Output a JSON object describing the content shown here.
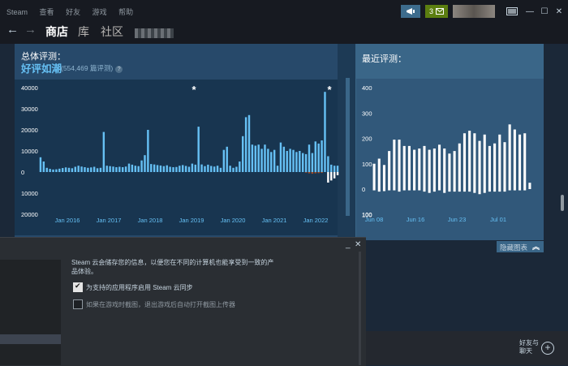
{
  "titlebar": {
    "menu": [
      "Steam",
      "查看",
      "好友",
      "游戏",
      "帮助"
    ],
    "friend_count": "3",
    "window_controls": [
      "—",
      "☐",
      "✕"
    ]
  },
  "navbar": {
    "back": "←",
    "forward": "→",
    "tabs": [
      "商店",
      "库",
      "社区"
    ],
    "active_tab": "商店"
  },
  "overall_reviews": {
    "label": "总体评测：",
    "rating": "好评如潮",
    "count": "(554,469 篇评测)",
    "help": "?"
  },
  "recent_reviews": {
    "label": "最近评测："
  },
  "hide_chart": {
    "label": "隐藏图表",
    "icon": "double-chevron-up-icon"
  },
  "dialog": {
    "controls": [
      "_",
      "✕"
    ],
    "description": "Steam 云会储存您的信息，以便您在不同的计算机也能享受到一致的产品体验。",
    "options": [
      {
        "label": "为支持的应用程序启用 Steam 云同步",
        "checked": true
      },
      {
        "label": "如果在游戏时截图，退出游戏后自动打开截图上传器",
        "checked": false
      }
    ]
  },
  "friends_chat": {
    "label_line1": "好友与",
    "label_line2": "聊天",
    "plus": "+"
  },
  "colors": {
    "accent": "#66c0f4",
    "positive_bar": "#66c0f4",
    "recent_bar": "#ffffff",
    "negative_bar": "#a34c25",
    "panel": "#27496a"
  },
  "chart_data": [
    {
      "type": "bar",
      "title": "",
      "y_ticks_positive": [
        "40000",
        "30000",
        "20000",
        "10000",
        "0"
      ],
      "y_ticks_negative": [
        "10000",
        "20000"
      ],
      "x_ticks": [
        "Jan 2016",
        "Jan 2017",
        "Jan 2018",
        "Jan 2019",
        "Jan 2020",
        "Jan 2021",
        "Jan 2022"
      ],
      "ylim": [
        -20000,
        40000
      ],
      "annotations": [
        "*",
        "*"
      ],
      "series": [
        {
          "values": [
            7000,
            5000,
            2000,
            1500,
            1200,
            1300,
            1600,
            1900,
            2200,
            2000,
            1800,
            2500,
            3000,
            2600,
            2300,
            2000,
            2200,
            2500,
            1800,
            2000,
            19000,
            3000,
            2800,
            2600,
            2300,
            2500,
            2300,
            2600,
            4000,
            3500,
            3000,
            2800,
            5500,
            8000,
            20000,
            3800,
            3600,
            3300,
            3100,
            2800,
            3200,
            2500,
            2300,
            2400,
            3000,
            3300,
            2900,
            2500,
            4000,
            3500,
            21500,
            3600,
            2800,
            3500,
            2900,
            2600,
            3000,
            2000,
            10500,
            12000,
            3000,
            2000,
            2500,
            5000,
            17000,
            26000,
            27000,
            13000,
            12500,
            13000,
            11000,
            13000,
            11000,
            9500,
            10500,
            3000,
            14000,
            12000,
            10000,
            11000,
            10500,
            9500,
            10000,
            9000,
            8500,
            13000,
            9000,
            14500,
            13500,
            15000,
            38000,
            7500,
            3500,
            3000,
            3000
          ],
          "negatives": [
            0,
            0,
            0,
            0,
            0,
            0,
            0,
            0,
            0,
            0,
            0,
            0,
            0,
            0,
            0,
            0,
            0,
            0,
            0,
            0,
            0,
            0,
            0,
            0,
            0,
            0,
            0,
            0,
            0,
            0,
            0,
            0,
            0,
            0,
            0,
            0,
            0,
            0,
            0,
            0,
            0,
            0,
            0,
            0,
            0,
            0,
            0,
            0,
            0,
            0,
            0,
            0,
            0,
            0,
            0,
            0,
            0,
            0,
            0,
            0,
            0,
            0,
            0,
            0,
            0,
            0,
            0,
            0,
            0,
            0,
            0,
            0,
            0,
            0,
            0,
            0,
            0,
            0,
            0,
            0,
            0,
            0,
            0,
            0,
            300,
            600,
            800,
            600,
            500,
            400,
            0,
            5000,
            4000,
            3000,
            1500
          ]
        }
      ]
    },
    {
      "type": "bar",
      "title": "",
      "y_ticks_positive": [
        "400",
        "300",
        "200",
        "100",
        "0"
      ],
      "y_ticks_negative": [
        "100"
      ],
      "x_ticks": [
        "Jun 08",
        "Jun 16",
        "Jun 23",
        "Jul 01"
      ],
      "ylim": [
        -100,
        400
      ],
      "series": [
        {
          "values": [
            100,
            120,
            95,
            150,
            195,
            195,
            170,
            170,
            155,
            160,
            170,
            155,
            160,
            175,
            160,
            140,
            150,
            180,
            220,
            230,
            220,
            190,
            215,
            170,
            180,
            215,
            185,
            255,
            235,
            215,
            220,
            25
          ],
          "negatives": [
            5,
            10,
            8,
            5,
            5,
            10,
            5,
            5,
            5,
            5,
            10,
            15,
            10,
            5,
            15,
            10,
            10,
            10,
            10,
            10,
            15,
            20,
            15,
            10,
            10,
            10,
            10,
            5,
            5,
            5,
            5,
            0
          ]
        }
      ]
    }
  ]
}
